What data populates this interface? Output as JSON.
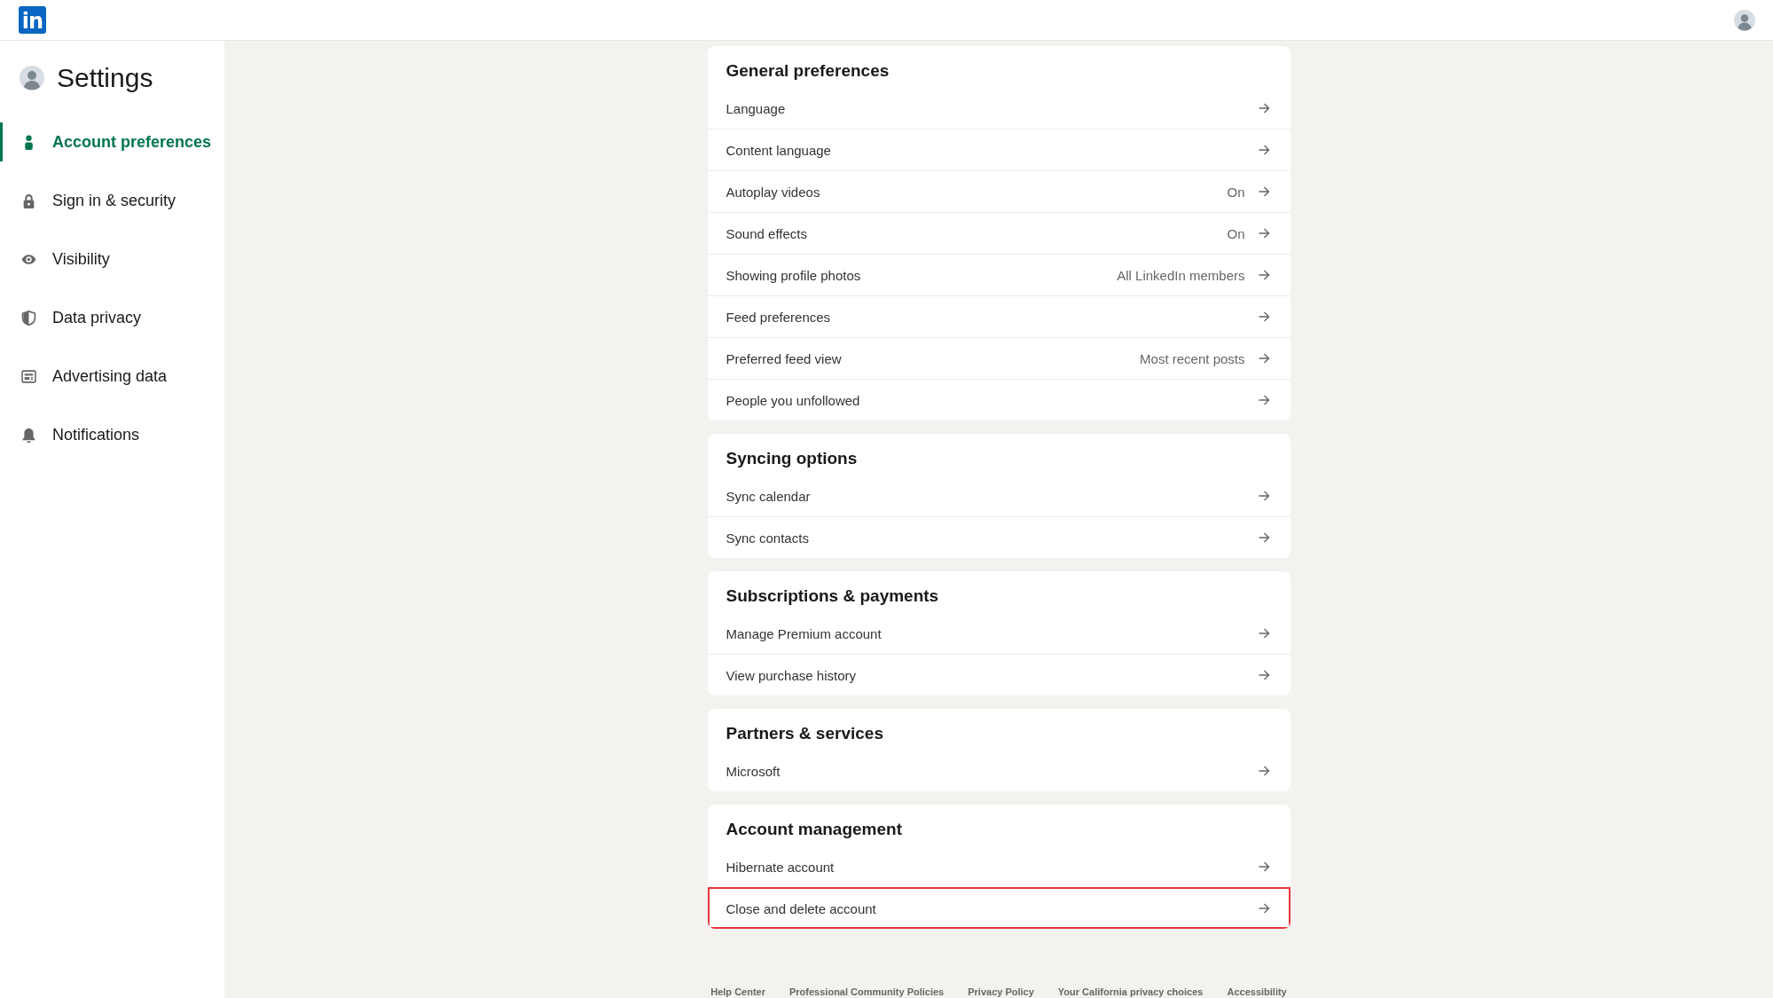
{
  "top_bar": {
    "logo": "in"
  },
  "sidebar": {
    "title": "Settings",
    "items": [
      {
        "label": "Account preferences",
        "selected": true
      },
      {
        "label": "Sign in & security",
        "selected": false
      },
      {
        "label": "Visibility",
        "selected": false
      },
      {
        "label": "Data privacy",
        "selected": false
      },
      {
        "label": "Advertising data",
        "selected": false
      },
      {
        "label": "Notifications",
        "selected": false
      }
    ]
  },
  "sections": [
    {
      "title": "General preferences",
      "rows": [
        {
          "label": "Language",
          "highlighted": false
        },
        {
          "label": "Content language",
          "highlighted": false
        },
        {
          "label": "Autoplay videos",
          "value": "On",
          "highlighted": false
        },
        {
          "label": "Sound effects",
          "value": "On",
          "highlighted": false
        },
        {
          "label": "Showing profile photos",
          "value": "All LinkedIn members",
          "highlighted": false
        },
        {
          "label": "Feed preferences",
          "highlighted": false
        },
        {
          "label": "Preferred feed view",
          "value": "Most recent posts",
          "highlighted": false
        },
        {
          "label": "People you unfollowed",
          "highlighted": false
        }
      ]
    },
    {
      "title": "Syncing options",
      "rows": [
        {
          "label": "Sync calendar",
          "highlighted": false
        },
        {
          "label": "Sync contacts",
          "highlighted": false
        }
      ]
    },
    {
      "title": "Subscriptions & payments",
      "rows": [
        {
          "label": "Manage Premium account",
          "highlighted": false
        },
        {
          "label": "View purchase history",
          "highlighted": false
        }
      ]
    },
    {
      "title": "Partners & services",
      "rows": [
        {
          "label": "Microsoft",
          "highlighted": false
        }
      ]
    },
    {
      "title": "Account management",
      "rows": [
        {
          "label": "Hibernate account",
          "highlighted": false
        },
        {
          "label": "Close and delete account",
          "highlighted": true
        }
      ]
    }
  ],
  "footer": {
    "links": [
      "Help Center",
      "Professional Community Policies",
      "Privacy Policy",
      "Your California privacy choices",
      "Accessibility"
    ]
  }
}
